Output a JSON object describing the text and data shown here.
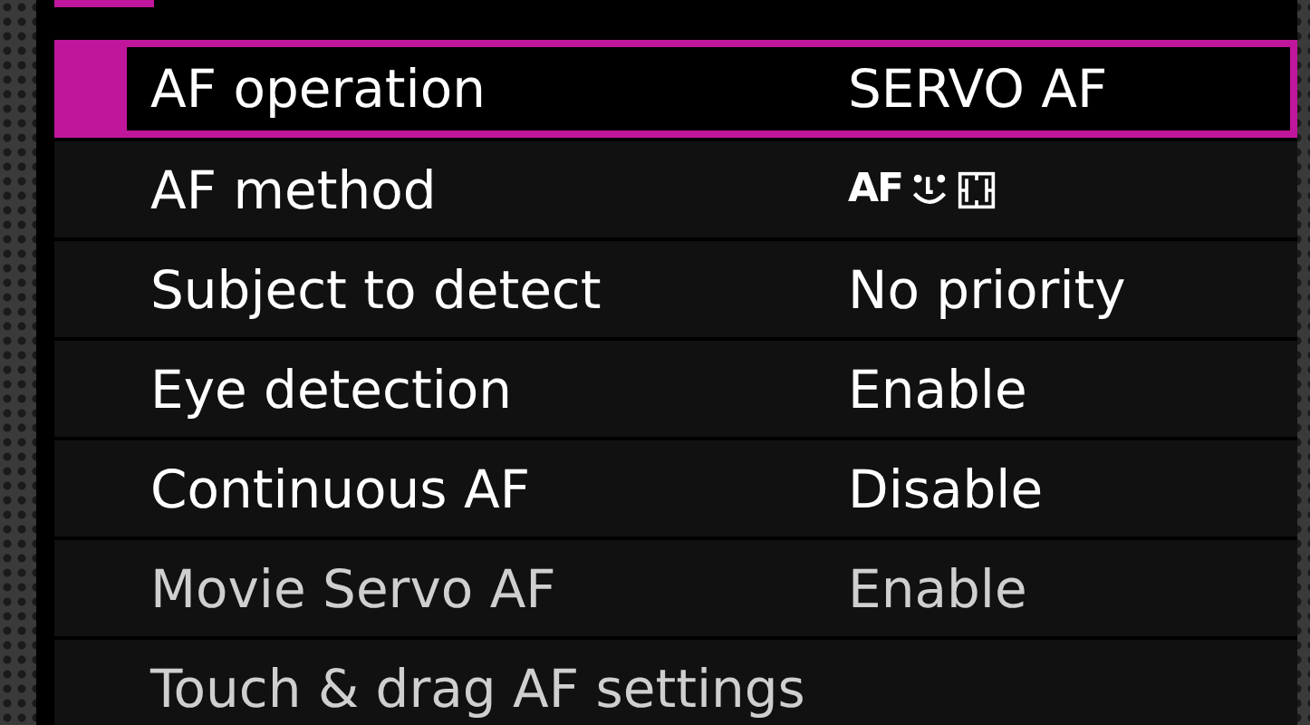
{
  "menu": {
    "items": [
      {
        "kind": "text",
        "label": "AF operation",
        "value": "SERVO AF",
        "selected": true,
        "dimmed": false
      },
      {
        "kind": "icons",
        "label": "AF method",
        "value": "AF",
        "selected": false,
        "dimmed": false
      },
      {
        "kind": "text",
        "label": "Subject to detect",
        "value": "No priority",
        "selected": false,
        "dimmed": false
      },
      {
        "kind": "text",
        "label": "Eye detection",
        "value": "Enable",
        "selected": false,
        "dimmed": false
      },
      {
        "kind": "text",
        "label": "Continuous AF",
        "value": "Disable",
        "selected": false,
        "dimmed": false
      },
      {
        "kind": "text",
        "label": "Movie Servo AF",
        "value": "Enable",
        "selected": false,
        "dimmed": true
      },
      {
        "kind": "submenu",
        "label": "Touch & drag AF settings",
        "selected": false,
        "dimmed": true
      }
    ]
  }
}
